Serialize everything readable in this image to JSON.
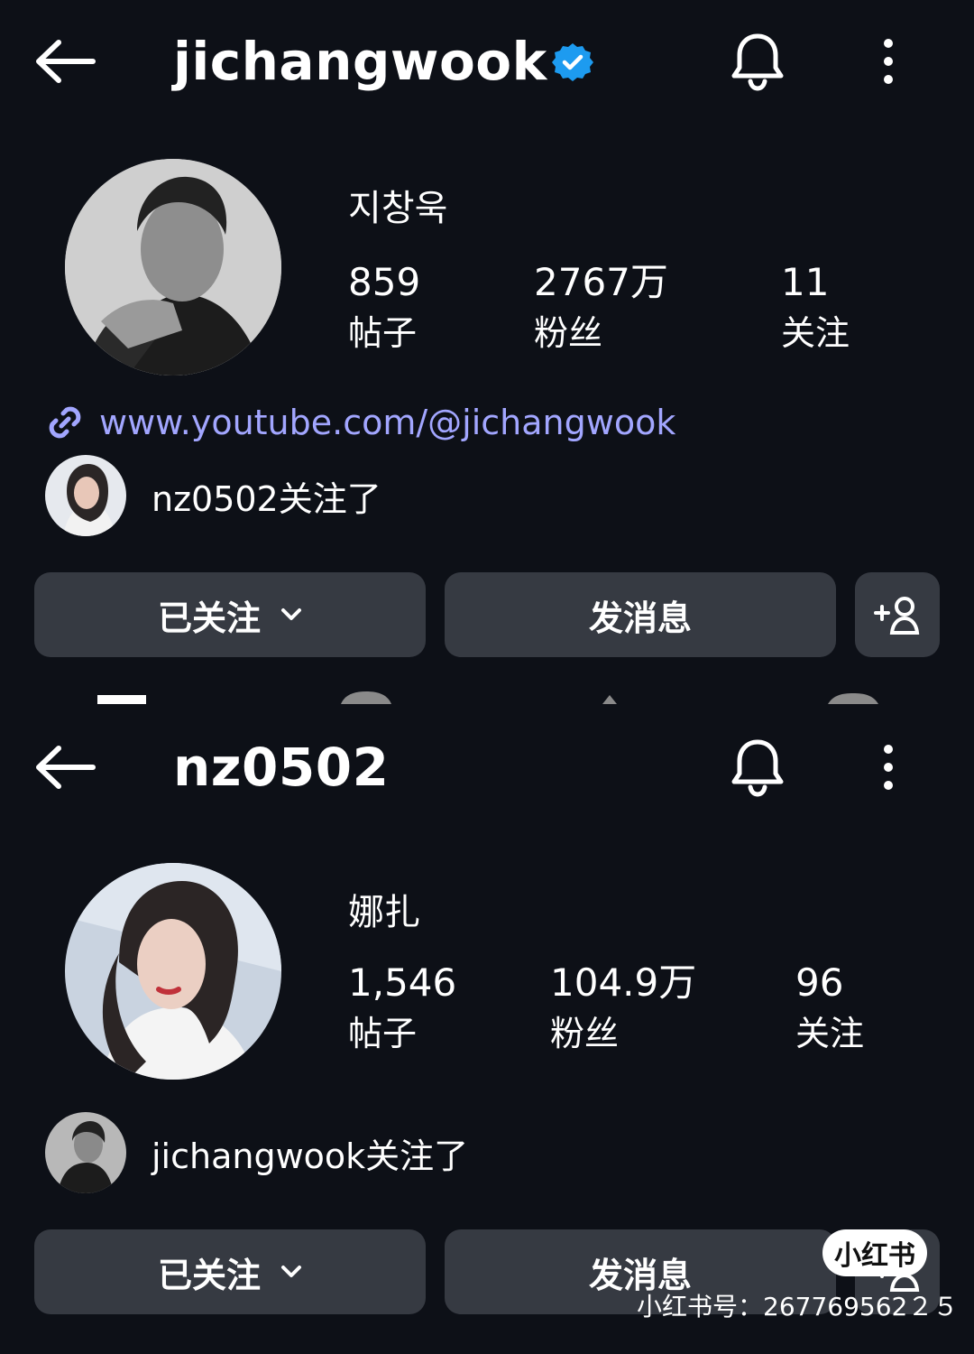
{
  "profiles": [
    {
      "username": "jichangwook",
      "verified": true,
      "display_name": "지창욱",
      "stats": [
        {
          "value": "859",
          "label": "帖子"
        },
        {
          "value": "2767万",
          "label": "粉丝"
        },
        {
          "value": "11",
          "label": "关注"
        }
      ],
      "link": "www.youtube.com/@jichangwook",
      "mutual_text": "nz0502关注了",
      "buttons": {
        "following": "已关注",
        "message": "发消息"
      }
    },
    {
      "username": "nz0502",
      "verified": false,
      "display_name": "娜扎",
      "stats": [
        {
          "value": "1,546",
          "label": "帖子"
        },
        {
          "value": "104.9万",
          "label": "粉丝"
        },
        {
          "value": "96",
          "label": "关注"
        }
      ],
      "mutual_text": "jichangwook关注了",
      "buttons": {
        "following": "已关注",
        "message": "发消息"
      }
    }
  ],
  "watermark": {
    "logo": "小红书",
    "id_text": "小红书号：267769562２５"
  },
  "colors": {
    "background": "#0d1017",
    "button": "#363a42",
    "link": "#a2a6ff",
    "verified": "#1d9bf0"
  },
  "icons": [
    "back-arrow-icon",
    "verified-badge-icon",
    "bell-icon",
    "more-vertical-icon",
    "link-icon",
    "chevron-down-icon",
    "add-person-icon"
  ]
}
